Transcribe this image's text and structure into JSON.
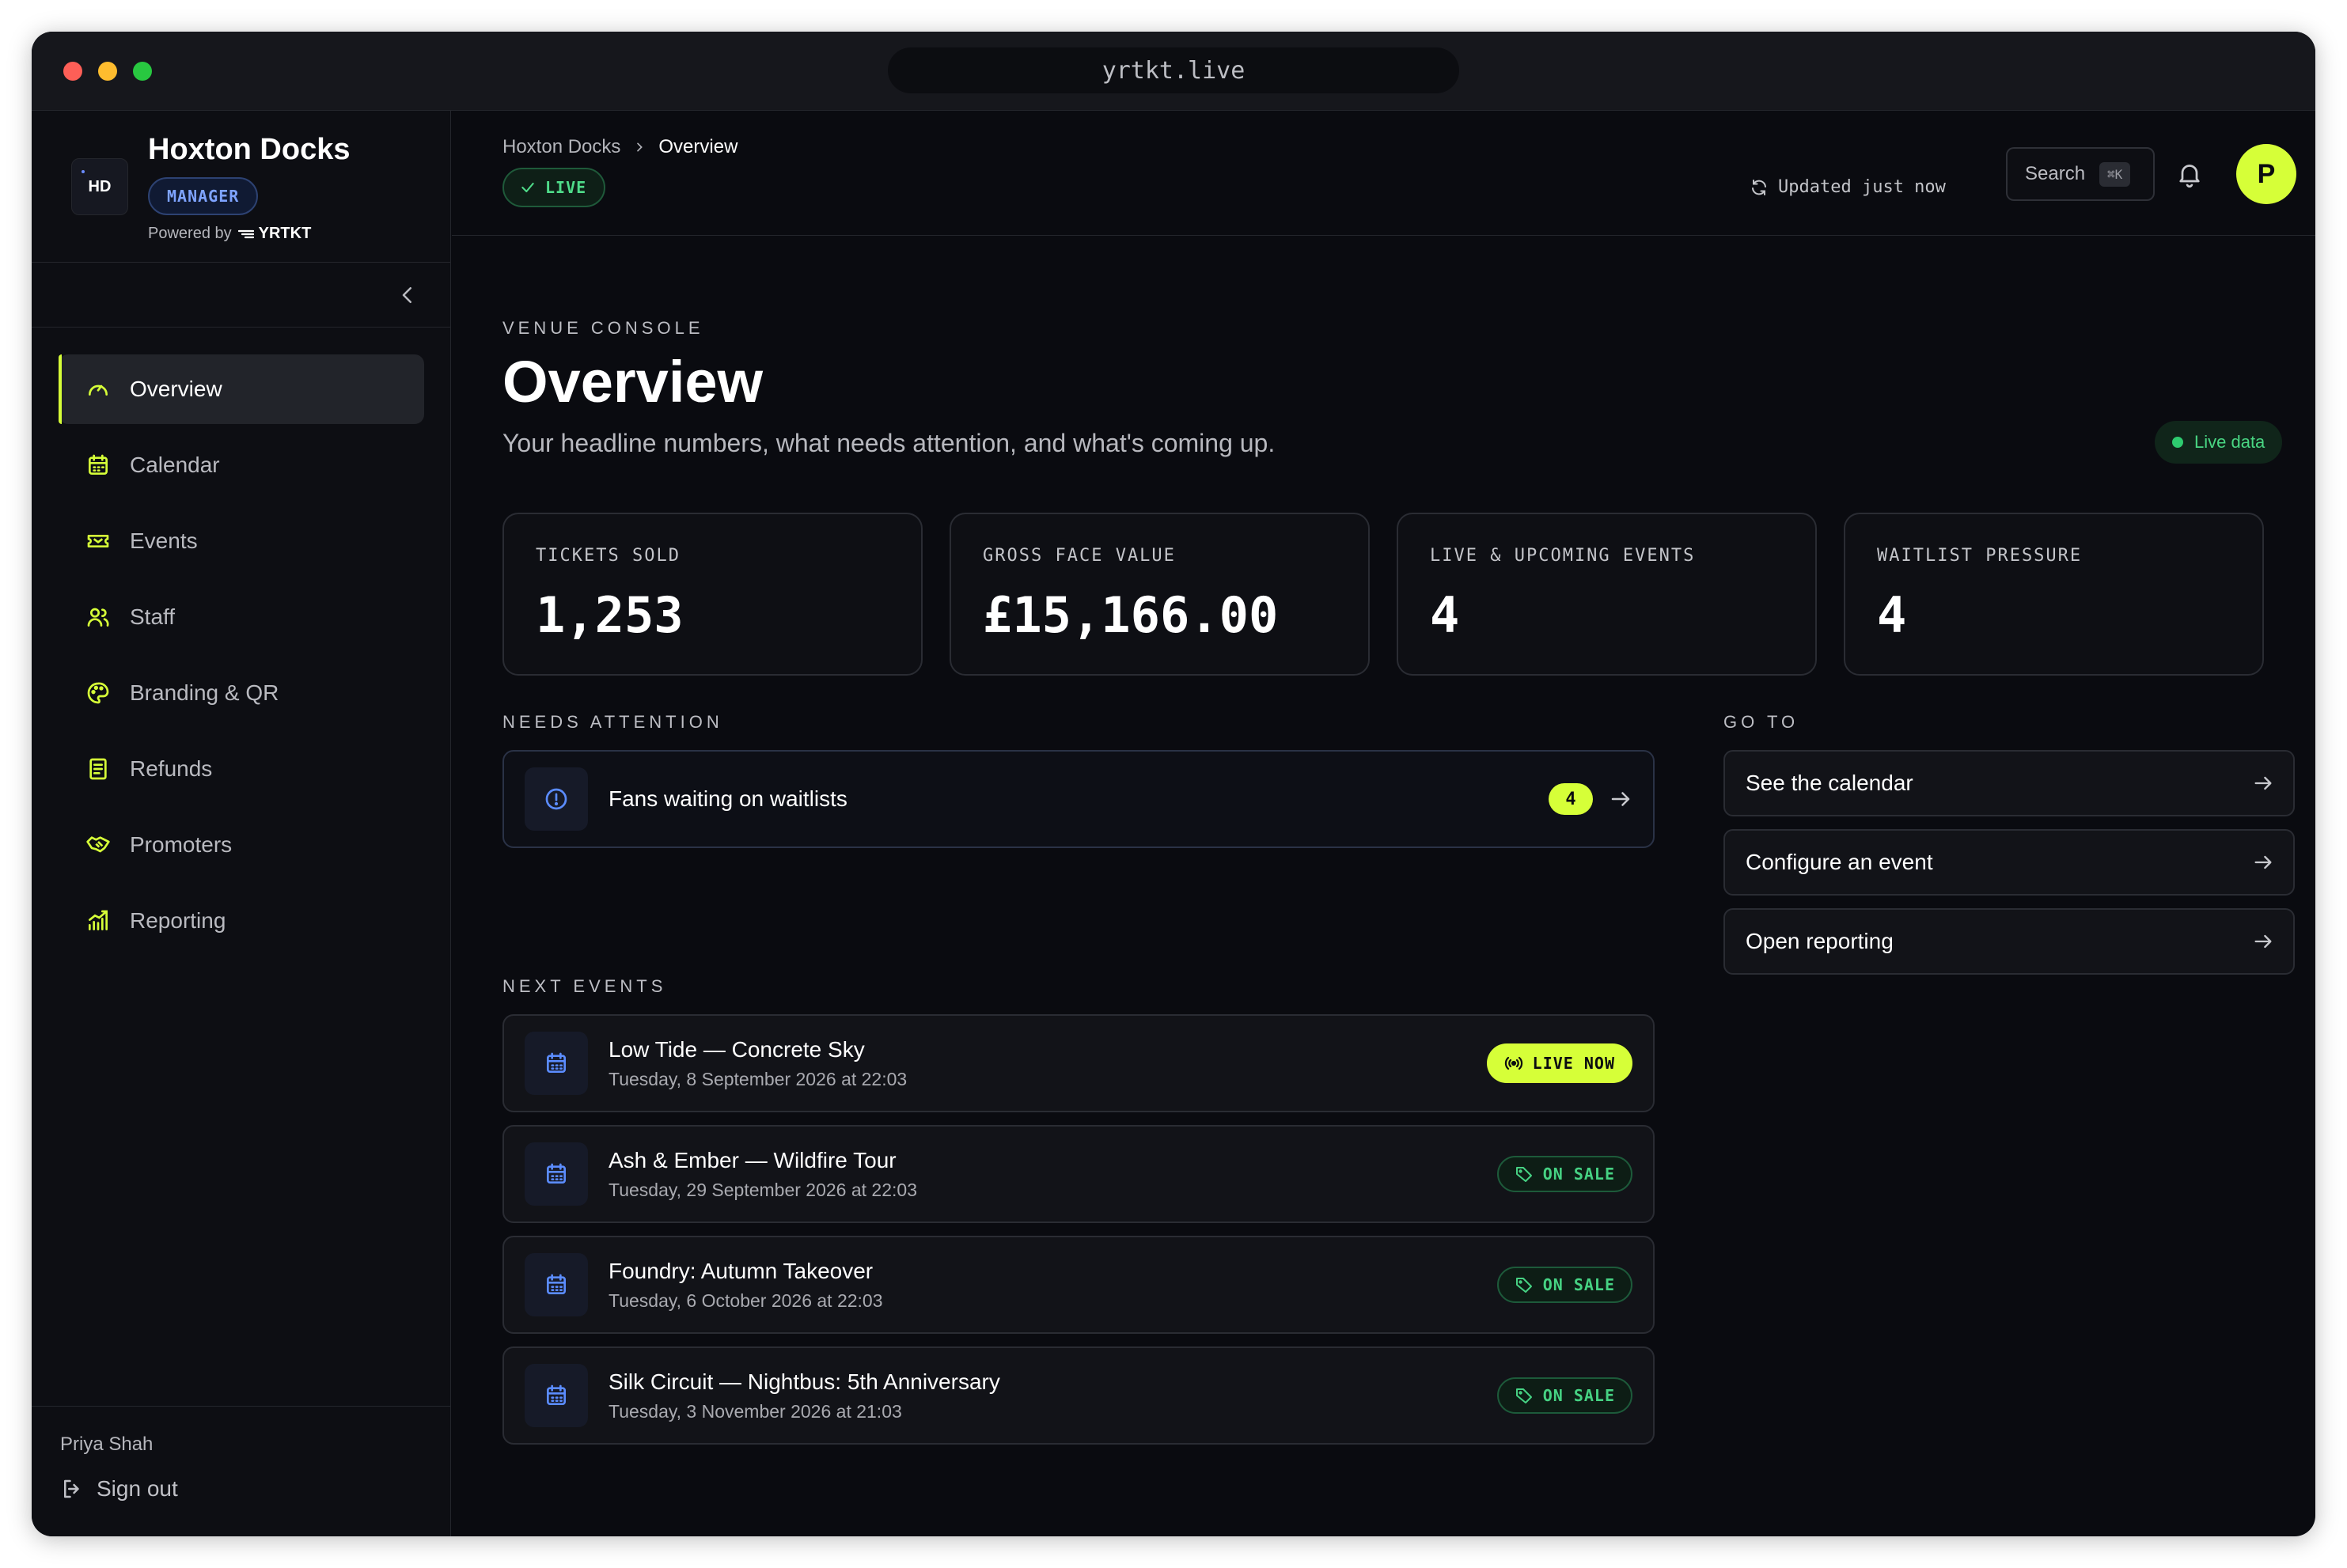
{
  "browser": {
    "url": "yrtkt.live"
  },
  "brand": {
    "logo_text": "HD",
    "name": "Hoxton Docks",
    "role": "MANAGER",
    "powered_by": "Powered by",
    "powered_brand": "YRTKT"
  },
  "sidebar": {
    "items": [
      {
        "label": "Overview",
        "icon": "gauge-icon",
        "active": true
      },
      {
        "label": "Calendar",
        "icon": "calendar-icon"
      },
      {
        "label": "Events",
        "icon": "ticket-icon"
      },
      {
        "label": "Staff",
        "icon": "users-icon"
      },
      {
        "label": "Branding & QR",
        "icon": "palette-icon"
      },
      {
        "label": "Refunds",
        "icon": "receipt-icon"
      },
      {
        "label": "Promoters",
        "icon": "handshake-icon"
      },
      {
        "label": "Reporting",
        "icon": "bar-chart-icon"
      }
    ],
    "user": "Priya Shah",
    "sign_out": "Sign out"
  },
  "topbar": {
    "breadcrumb": [
      "Hoxton Docks",
      "Overview"
    ],
    "status": "LIVE",
    "updated": "Updated just now",
    "search_label": "Search",
    "search_shortcut": "⌘K",
    "avatar_initial": "P"
  },
  "page": {
    "eyebrow": "VENUE CONSOLE",
    "title": "Overview",
    "subtitle": "Your headline numbers, what needs attention, and what's coming up.",
    "live_data": "Live data"
  },
  "kpis": [
    {
      "label": "TICKETS SOLD",
      "value": "1,253"
    },
    {
      "label": "GROSS FACE VALUE",
      "value": "£15,166.00"
    },
    {
      "label": "LIVE & UPCOMING EVENTS",
      "value": "4"
    },
    {
      "label": "WAITLIST PRESSURE",
      "value": "4"
    }
  ],
  "attention": {
    "heading": "NEEDS ATTENTION",
    "items": [
      {
        "label": "Fans waiting on waitlists",
        "count": "4"
      }
    ]
  },
  "next_events": {
    "heading": "NEXT EVENTS",
    "items": [
      {
        "name": "Low Tide — Concrete Sky",
        "date": "Tuesday, 8 September 2026 at 22:03",
        "status": "LIVE NOW"
      },
      {
        "name": "Ash & Ember — Wildfire Tour",
        "date": "Tuesday, 29 September 2026 at 22:03",
        "status": "ON SALE"
      },
      {
        "name": "Foundry: Autumn Takeover",
        "date": "Tuesday, 6 October 2026 at 22:03",
        "status": "ON SALE"
      },
      {
        "name": "Silk Circuit — Nightbus: 5th Anniversary",
        "date": "Tuesday, 3 November 2026 at 21:03",
        "status": "ON SALE"
      }
    ]
  },
  "goto": {
    "heading": "GO TO",
    "items": [
      "See the calendar",
      "Configure an event",
      "Open reporting"
    ]
  },
  "colors": {
    "accent": "#d6ff38",
    "success": "#46d283",
    "info": "#7ea3ff",
    "background": "#0a0b10"
  }
}
